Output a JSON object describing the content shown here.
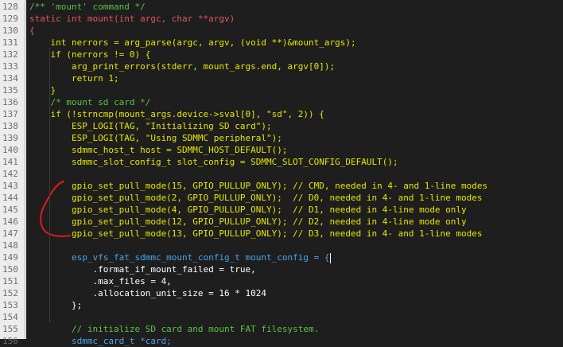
{
  "editor": {
    "highlighted_line": "149",
    "selection_on_line": "152",
    "lines": [
      {
        "num": "128",
        "text": "/** 'mount' command */",
        "color": "#57c442"
      },
      {
        "num": "129",
        "text": "static int mount(int argc, char **argv)",
        "color": "#e05757"
      },
      {
        "num": "130",
        "text": "{",
        "color": "#e05757"
      },
      {
        "num": "131",
        "text": "    int nerrors = arg_parse(argc, argv, (void **)&mount_args);",
        "color": "#e6e600"
      },
      {
        "num": "132",
        "text": "    if (nerrors != 0) {",
        "color": "#e6e600"
      },
      {
        "num": "133",
        "text": "        arg_print_errors(stderr, mount_args.end, argv[0]);",
        "color": "#e6e600"
      },
      {
        "num": "134",
        "text": "        return 1;",
        "color": "#e6e600"
      },
      {
        "num": "135",
        "text": "    }",
        "color": "#e6e600"
      },
      {
        "num": "136",
        "text": "    /* mount sd card */",
        "color": "#57c442"
      },
      {
        "num": "137",
        "text": "    if (!strncmp(mount_args.device->sval[0], \"sd\", 2)) {",
        "color": "#e6e600"
      },
      {
        "num": "138",
        "text": "        ESP_LOGI(TAG, \"Initializing SD card\");",
        "color": "#e6e600"
      },
      {
        "num": "139",
        "text": "        ESP_LOGI(TAG, \"Using SDMMC peripheral\");",
        "color": "#e6e600"
      },
      {
        "num": "140",
        "text": "        sdmmc_host_t host = SDMMC_HOST_DEFAULT();",
        "color": "#e6e600"
      },
      {
        "num": "141",
        "text": "        sdmmc_slot_config_t slot_config = SDMMC_SLOT_CONFIG_DEFAULT();",
        "color": "#e6e600"
      },
      {
        "num": "142",
        "text": "",
        "color": "#e6e600"
      },
      {
        "num": "143",
        "text": "        gpio_set_pull_mode(15, GPIO_PULLUP_ONLY); // CMD, needed in 4- and 1-line modes",
        "color": "#e6e600"
      },
      {
        "num": "144",
        "text": "        gpio_set_pull_mode(2, GPIO_PULLUP_ONLY);  // D0, needed in 4- and 1-line modes",
        "color": "#e6e600"
      },
      {
        "num": "145",
        "text": "        gpio_set_pull_mode(4, GPIO_PULLUP_ONLY);  // D1, needed in 4-line mode only",
        "color": "#e6e600"
      },
      {
        "num": "146",
        "text": "        gpio_set_pull_mode(12, GPIO_PULLUP_ONLY); // D2, needed in 4-line mode only",
        "color": "#e6e600"
      },
      {
        "num": "147",
        "text": "        gpio_set_pull_mode(13, GPIO_PULLUP_ONLY); // D3, needed in 4- and 1-line modes",
        "color": "#e6e600"
      },
      {
        "num": "148",
        "text": "",
        "color": "#e6e600"
      },
      {
        "num": "149",
        "text": "        esp_vfs_fat_sdmmc_mount_config_t mount_config = {",
        "color": "#4aa3e8"
      },
      {
        "num": "150",
        "text": "            .format_if_mount_failed = true,",
        "color": "#ffffff"
      },
      {
        "num": "151",
        "text": "            .max_files = 4,",
        "color": "#ffffff"
      },
      {
        "num": "152",
        "text": "            .allocation_unit_size = 16 * 1024",
        "color": "#ffffff"
      },
      {
        "num": "153",
        "text": "        };",
        "color": "#ffffff"
      },
      {
        "num": "154",
        "text": "",
        "color": "#ffffff"
      },
      {
        "num": "155",
        "text": "        // initialize SD card and mount FAT filesystem.",
        "color": "#57c442"
      },
      {
        "num": "156",
        "text": "        sdmmc_card_t *card;",
        "color": "#4aa3e8"
      }
    ]
  },
  "colors": {
    "annotation": "#e01a1a"
  }
}
